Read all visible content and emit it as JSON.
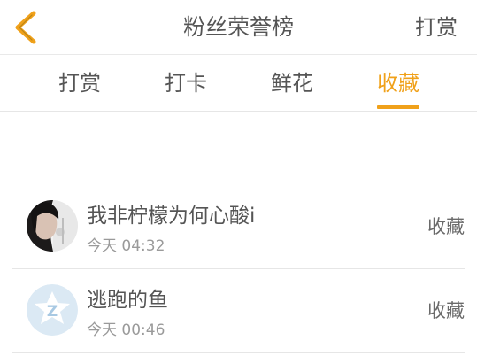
{
  "header": {
    "title": "粉丝荣誉榜",
    "right_action": "打赏",
    "accent": "#f0a11a"
  },
  "tabs": [
    {
      "label": "打赏",
      "active": false
    },
    {
      "label": "打卡",
      "active": false
    },
    {
      "label": "鲜花",
      "active": false
    },
    {
      "label": "收藏",
      "active": true
    }
  ],
  "fans": [
    {
      "name": "我非柠檬为何心酸i",
      "time": "今天 04:32",
      "action": "收藏",
      "avatar_icon": "girl-photo-avatar"
    },
    {
      "name": "逃跑的鱼",
      "time": "今天 00:46",
      "action": "收藏",
      "avatar_icon": "default-z-avatar"
    }
  ]
}
